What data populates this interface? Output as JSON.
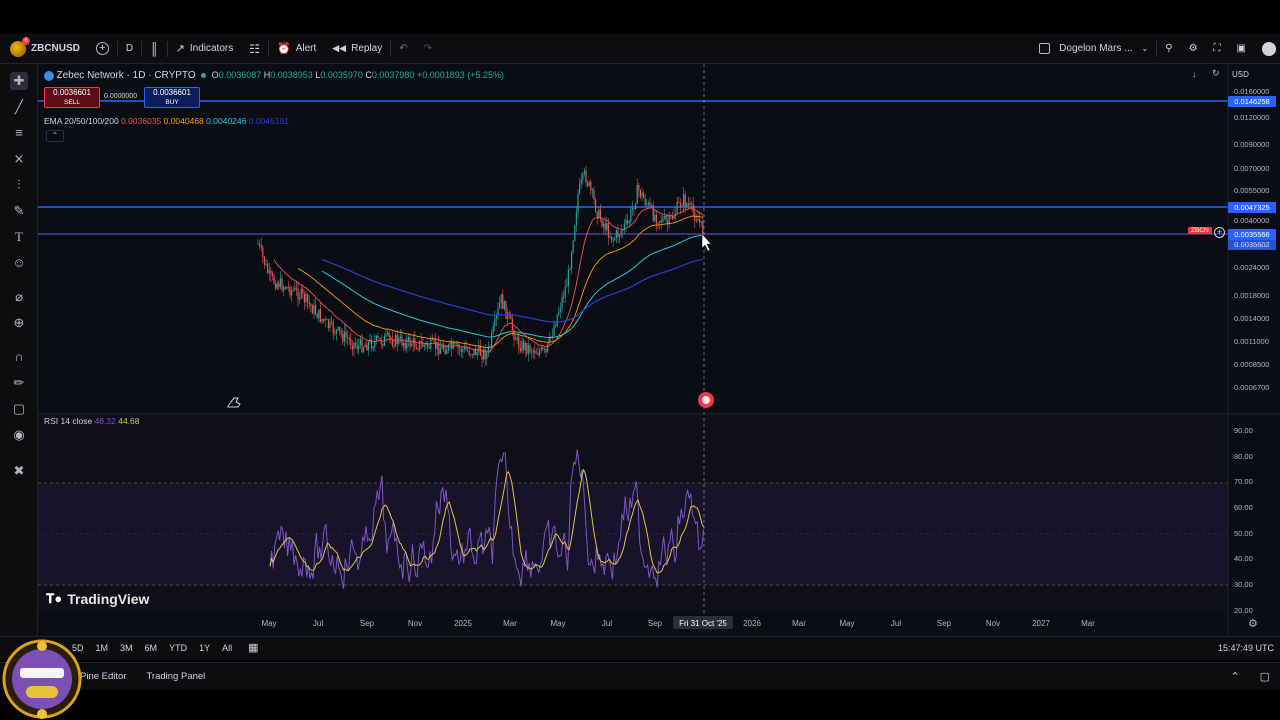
{
  "toolbar": {
    "symbol": "ZBCNUSD",
    "interval": "D",
    "indicators_label": "Indicators",
    "alert_label": "Alert",
    "replay_label": "Replay",
    "layout_name": "Dogelon Mars ...",
    "currency": "USD"
  },
  "legend": {
    "title": "Zebec Network · 1D · CRYPTO",
    "ohlc": {
      "o_label": "O",
      "o": "0.0036087",
      "h_label": "H",
      "h": "0.0038953",
      "l_label": "L",
      "l": "0.0035970",
      "c_label": "C",
      "c": "0.0037980",
      "change": "+0.0001893 (+5.25%)"
    },
    "sell_price": "0.0036601",
    "sell_label": "SELL",
    "spread": "0.0000000",
    "buy_price": "0.0036601",
    "buy_label": "BUY",
    "ema_label": "EMA 20/50/100/200",
    "ema_values": [
      "0.0036035",
      "0.0040468",
      "0.0040246",
      "0.0045191"
    ],
    "rsi_label": "RSI 14 close",
    "rsi_values": [
      "46.32",
      "44.68"
    ]
  },
  "price_axis": [
    "0.0160000",
    "0.0120000",
    "0.0090000",
    "0.0070000",
    "0.0055000",
    "0.0040000",
    "0.0030000",
    "0.0024000",
    "0.0018000",
    "0.0014000",
    "0.0011000",
    "0.0008500",
    "0.0006700"
  ],
  "price_tags": {
    "upper_line": "0.0146258",
    "mid_line": "0.0047325",
    "current": "0.0035566",
    "current2": "0.0035602",
    "symbol_tag": "ZBCN"
  },
  "rsi_axis": [
    "90.00",
    "80.00",
    "70.00",
    "60.00",
    "50.00",
    "40.00",
    "30.00",
    "20.00"
  ],
  "time_axis": [
    "May",
    "Jul",
    "Sep",
    "Nov",
    "2025",
    "Mar",
    "May",
    "Jul",
    "Sep",
    "Fri 31 Oct '25",
    "2026",
    "Mar",
    "May",
    "Jul",
    "Sep",
    "Nov",
    "2027",
    "Mar"
  ],
  "watermark": "TradingView",
  "ranges": [
    "5D",
    "1M",
    "3M",
    "6M",
    "YTD",
    "1Y",
    "All"
  ],
  "clock": "15:47:49 UTC",
  "panels": [
    "Pine Editor",
    "Trading Panel"
  ],
  "colors": {
    "accent": "#2962ff",
    "up": "#26a69a",
    "down": "#ef5350",
    "rsi": "#7e57c2",
    "rsi_ma": "#e0c341"
  }
}
